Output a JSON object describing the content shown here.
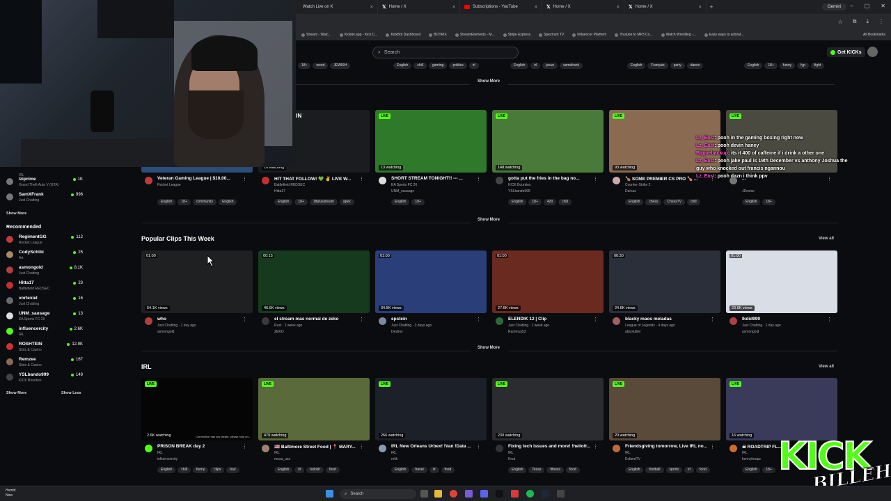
{
  "browser": {
    "tabs": [
      {
        "title": "Watch Live on K",
        "icon": "kick-icon"
      },
      {
        "title": "Home / X",
        "icon": "x-icon"
      },
      {
        "title": "Subscriptions - YouTube",
        "icon": "youtube-icon"
      },
      {
        "title": "Home / X",
        "icon": "x-icon"
      },
      {
        "title": "Home / X",
        "icon": "x-icon"
      }
    ],
    "new_tab": "+",
    "gemini_label": "Gemini",
    "bookmarks": [
      "Stream - Watc...",
      "Kicklet.app - Kick C...",
      "KickBot Dashboard",
      "BOTRIX",
      "StreamElements - M...",
      "Stripe Express",
      "Spectrum TV",
      "Influencer Platform",
      "Youtube to MP3 Co...",
      "Watch Wrestling -...",
      "Easy ways to activat..."
    ],
    "all_bookmarks": "All Bookmarks"
  },
  "header": {
    "search_placeholder": "Search",
    "get_kicks": "Get KICKs"
  },
  "top_tags": [
    [
      "18+",
      "weed",
      "JEWISH"
    ],
    [
      "English",
      "chill",
      "gaming",
      "politics",
      "irl"
    ],
    [
      "English",
      "irl",
      "jesus",
      "samxfrank"
    ],
    [
      "English",
      "Français",
      "party",
      "dance"
    ],
    [
      "English",
      "18+",
      "funny",
      "fyp",
      "fight"
    ]
  ],
  "show_more": "Show More",
  "sidebar": {
    "top_items": [
      {
        "name": "",
        "cat": "IRL",
        "count": ""
      },
      {
        "name": "lziprime",
        "cat": "Grand Theft Auto V (GTA)",
        "count": "1K"
      },
      {
        "name": "SamXFrank",
        "cat": "Just Chatting",
        "count": "996"
      }
    ],
    "show_more": "Show More",
    "recommended_title": "Recommended",
    "recommended": [
      {
        "name": "RegimentGG",
        "cat": "Rocket League",
        "count": "112",
        "color": "#c23b3b"
      },
      {
        "name": "CodySchibi",
        "cat": "Art",
        "count": "25",
        "color": "#a88a6a"
      },
      {
        "name": "asmongold",
        "cat": "Just Chatting",
        "count": "8.1K",
        "color": "#b04040"
      },
      {
        "name": "Hitta17",
        "cat": "Battlefield REDSEC",
        "count": "23",
        "color": "#c23030"
      },
      {
        "name": "vortexiel",
        "cat": "Just Chatting",
        "count": "16",
        "color": "#6a6a6a"
      },
      {
        "name": "UNM_sausage",
        "cat": "EA Sports FC 26",
        "count": "13",
        "color": "#dddddd"
      },
      {
        "name": "influencercity",
        "cat": "IRL",
        "count": "2.6K",
        "color": "#53fc18"
      },
      {
        "name": "ROSHTEIN",
        "cat": "Slots & Casino",
        "count": "12.9K",
        "color": "#d03030"
      },
      {
        "name": "Remzee",
        "cat": "Slots & Casino",
        "count": "167",
        "color": "#8a6a5a"
      },
      {
        "name": "YSLbando999",
        "cat": "KICK Bounties",
        "count": "149",
        "color": "#444"
      }
    ],
    "show_more_bottom": "Show More",
    "show_less": "Show Less"
  },
  "row1": [
    {
      "title": "Veteran Gaming League | $10,00...",
      "cat": "Rocket League",
      "tags": [
        "English",
        "18+",
        "community",
        "English"
      ],
      "viewers": "",
      "thumb_color": "#2a4d7a",
      "avatar": "#c23b3b"
    },
    {
      "title": "HIT THAT FOLLOW! 💚 ✌ LIVE W...",
      "cat": "Battlefield REDSEC",
      "channel": "Hitta17",
      "tags": [
        "English",
        "18+",
        "18plusstream",
        "apex"
      ],
      "viewers": "10 watching",
      "thumb_color": "#1a1c20",
      "avatar": "#c23030",
      "banner": "BE BACK SOON"
    },
    {
      "title": "SHORT STREAM TONIGHT!! --- ...",
      "cat": "EA Sports FC 26",
      "channel": "UNM_sausage",
      "tags": [
        "English",
        "18+"
      ],
      "viewers": "13 watching",
      "thumb_color": "#2f7a2a",
      "avatar": "#dddddd"
    },
    {
      "title": "gotta put the fries in the bag no...",
      "cat": "KICK Bounties",
      "channel": "YSLbando999",
      "tags": [
        "English",
        "18+",
        "420",
        "chill"
      ],
      "viewers": "148 watching",
      "thumb_color": "#4a7a3a",
      "avatar": "#444"
    },
    {
      "title": "🍗 SOME PREMIER CS PRO 🍗 ...",
      "cat": "Counter-Strike 2",
      "channel": "Darcas",
      "tags": [
        "English",
        "chess",
        "ChessTV",
        "chill"
      ],
      "viewers": "93 watching",
      "thumb_color": "#8a6a50",
      "avatar": "#caa"
    },
    {
      "title": "...",
      "cat": "",
      "channel": "JDevise",
      "tags": [
        "English",
        "18+"
      ],
      "viewers": "",
      "thumb_color": "#4a4a40",
      "avatar": "#777"
    }
  ],
  "clips": {
    "title": "Popular Clips This Week",
    "view_all": "View all",
    "items": [
      {
        "title": "who",
        "cat": "Just Chatting",
        "age": "1 day ago",
        "channel": "asmongold",
        "duration": "01:00",
        "views": "54.1K views",
        "thumb_color": "#1e2022",
        "avatar": "#b04040"
      },
      {
        "title": "el stream mas normal de zeko",
        "cat": "Rust",
        "age": "1 week ago",
        "channel": "ZEKO",
        "duration": "00:15",
        "views": "46.6K views",
        "thumb_color": "#163a1e",
        "avatar": "#3a3a3a"
      },
      {
        "title": "epstein",
        "cat": "Just Chatting",
        "age": "3 days ago",
        "channel": "Destiny",
        "duration": "01:00",
        "views": "34.5K views",
        "thumb_color": "#2a3e7a",
        "avatar": "#7a8aa0"
      },
      {
        "title": "ELENDIK 12 | Clip",
        "cat": "Just Chatting",
        "age": "1 week ago",
        "channel": "Rammus53",
        "duration": "01:00",
        "views": "27.6K views",
        "thumb_color": "#6a2a20",
        "avatar": "#2a6a3a"
      },
      {
        "title": "blacky maos meladas",
        "cat": "League of Legends",
        "age": "4 days ago",
        "channel": "absolutliel",
        "duration": "00:30",
        "views": "24.6K views",
        "thumb_color": "#2a2f3a",
        "avatar": "#a06060"
      },
      {
        "title": "lkdid999",
        "cat": "Just Chatting",
        "age": "1 day ago",
        "channel": "asmongold",
        "duration": "01:00",
        "views": "23.6K views",
        "thumb_color": "#d8dde6",
        "avatar": "#b04040"
      }
    ]
  },
  "irl": {
    "title": "IRL",
    "view_all": "View all",
    "items": [
      {
        "title": "PRISON BREAK day 2",
        "cat": "IRL",
        "channel": "influencercity",
        "viewers": "2.6K watching",
        "tags": [
          "English",
          "chill",
          "funny",
          "clips",
          "tour"
        ],
        "thumb_color": "#050505",
        "avatar": "#53fc18",
        "note": "Connection has low bitrate, please hold on..."
      },
      {
        "title": "🇺🇸 Baltimore Street Food | 📍 MARY...",
        "cat": "IRL",
        "channel": "musa_usa",
        "viewers": "479 watching",
        "tags": [
          "English",
          "irl",
          "turkish",
          "food"
        ],
        "thumb_color": "#5a6a3a",
        "avatar": "#a08070"
      },
      {
        "title": "IRL New Orleans Urbex! !Van !Data ...",
        "cat": "IRL",
        "channel": "relik",
        "viewers": "266 watching",
        "tags": [
          "English",
          "travel",
          "irl",
          "food"
        ],
        "thumb_color": "#1c2028",
        "avatar": "#8a9ab0"
      },
      {
        "title": "Fixing tech issues and more! !hellofr...",
        "cat": "IRL",
        "channel": "Knut",
        "viewers": "230 watching",
        "tags": [
          "English",
          "Texas",
          "fitness",
          "food"
        ],
        "thumb_color": "#2a2c30",
        "avatar": "#333"
      },
      {
        "title": "Friendsgiving tomorrow, Live IRL no...",
        "cat": "IRL",
        "channel": "EsfandTV",
        "viewers": "20 watching",
        "tags": [
          "English",
          "football",
          "sports",
          "irl",
          "food"
        ],
        "thumb_color": "#5a4a3a",
        "avatar": "#c06a3a"
      },
      {
        "title": "☠ ROADTRIP FL...",
        "cat": "IRL",
        "channel": "kennyhoopz",
        "viewers": "16 watching",
        "tags": [
          "English",
          "18+"
        ],
        "thumb_color": "#3a3a5a",
        "avatar": "#d06a30"
      }
    ]
  },
  "chat": [
    {
      "user": "Lz_East",
      "msg": ": pooh in the gaming boxing right now"
    },
    {
      "user": "Lz_East",
      "msg": ": pooh devin haney"
    },
    {
      "user": "Bigjoebackup",
      "msg": ": its it 400 of caffeine if i drink a other one"
    },
    {
      "user": "Lz_East",
      "msg": ": pooh jake paul is 19th December vs anthony Joshua the"
    },
    {
      "user": "",
      "msg": "guy who knocked out francis ngannou"
    },
    {
      "user": "Lz_East",
      "msg": ": pooh dazn i think ppv"
    }
  ],
  "overlay_logo": {
    "top": "KICK",
    "bottom": "BILLEH"
  },
  "taskbar": {
    "weather_label": "Humid",
    "weather_sub": "Now",
    "search": "Search"
  }
}
